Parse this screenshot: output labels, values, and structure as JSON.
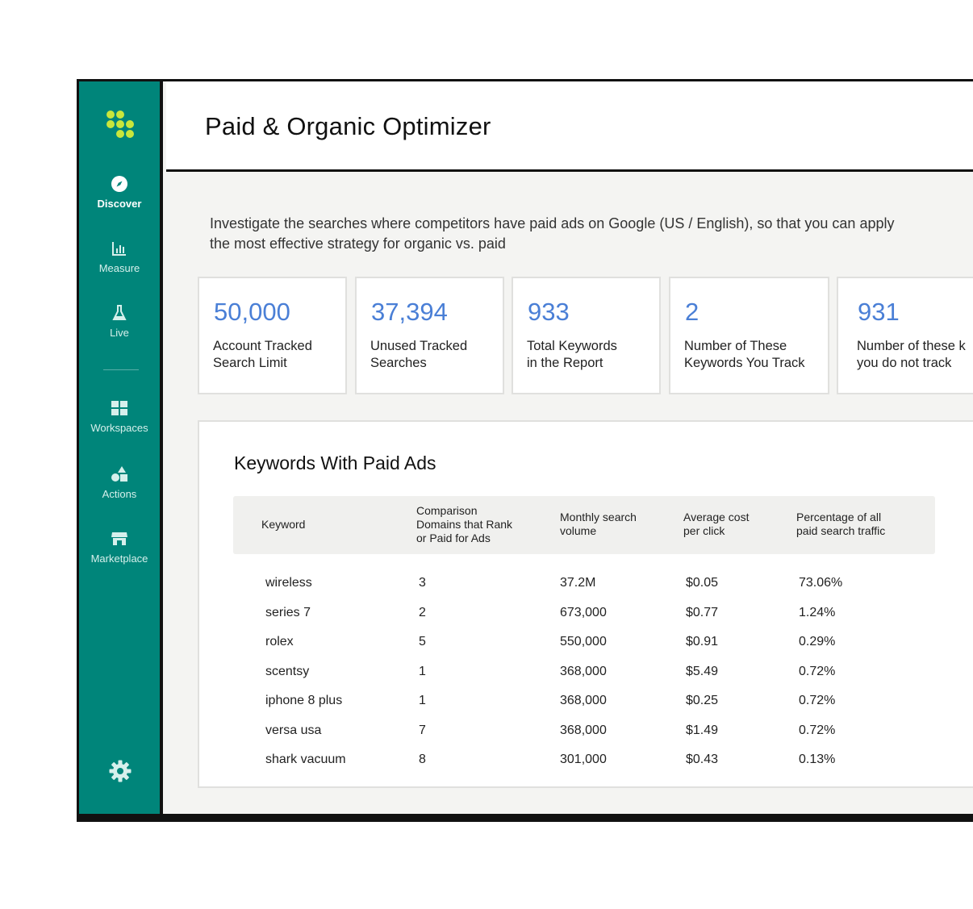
{
  "colors": {
    "sidebar": "#00857a",
    "accent_number": "#4a7fd6",
    "logo": "#c8e63c"
  },
  "sidebar": {
    "logo_icon": "dots-logo-icon",
    "items": [
      {
        "label": "Discover",
        "icon": "compass-icon",
        "active": true
      },
      {
        "label": "Measure",
        "icon": "bar-chart-icon"
      },
      {
        "label": "Live",
        "icon": "flask-icon"
      },
      {
        "label": "Workspaces",
        "icon": "grid-icon"
      },
      {
        "label": "Actions",
        "icon": "shapes-icon"
      },
      {
        "label": "Marketplace",
        "icon": "storefront-icon"
      }
    ],
    "settings_icon": "gear-icon"
  },
  "header": {
    "title": "Paid & Organic Optimizer"
  },
  "description": "Investigate the searches where competitors have paid ads on Google (US / English), so that you can apply the most effective strategy for organic vs. paid",
  "stats": [
    {
      "value": "50,000",
      "label_line1": "Account Tracked",
      "label_line2": "Search Limit"
    },
    {
      "value": "37,394",
      "label_line1": "Unused Tracked",
      "label_line2": "Searches"
    },
    {
      "value": "933",
      "label_line1": "Total Keywords",
      "label_line2": "in the Report"
    },
    {
      "value": "2",
      "label_line1": "Number of These",
      "label_line2": "Keywords You Track"
    },
    {
      "value": "931",
      "label_line1": "Number of these k",
      "label_line2": "you do not track"
    }
  ],
  "table": {
    "title": "Keywords With Paid Ads",
    "headers": [
      "Keyword",
      "Comparison\nDomains that Rank\nor Paid for Ads",
      "Monthly search\nvolume",
      "Average cost\nper click",
      "Percentage of all\npaid search traffic"
    ],
    "rows": [
      [
        "wireless",
        "3",
        "37.2M",
        "$0.05",
        "73.06%"
      ],
      [
        "series 7",
        "2",
        "673,000",
        "$0.77",
        "1.24%"
      ],
      [
        "rolex",
        "5",
        "550,000",
        "$0.91",
        "0.29%"
      ],
      [
        "scentsy",
        "1",
        "368,000",
        "$5.49",
        "0.72%"
      ],
      [
        "iphone 8 plus",
        "1",
        "368,000",
        "$0.25",
        "0.72%"
      ],
      [
        "versa usa",
        "7",
        "368,000",
        "$1.49",
        "0.72%"
      ],
      [
        "shark vacuum",
        "8",
        "301,000",
        "$0.43",
        "0.13%"
      ]
    ]
  }
}
